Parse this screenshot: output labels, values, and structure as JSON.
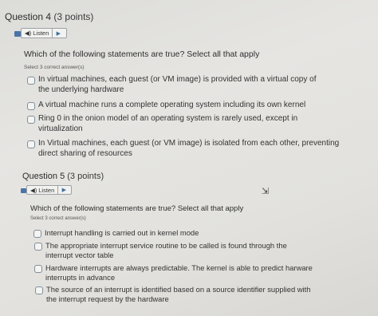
{
  "questions": [
    {
      "title": "Question 4",
      "points": "(3 points)",
      "listen_label": "Listen",
      "prompt": "Which of the following statements are true? Select all that apply",
      "select_hint": "Select 3 correct answer(s)",
      "options": [
        {
          "line1": "In virtual machines, each guest (or VM image) is provided with a virtual copy of",
          "line2": "the underlying hardware"
        },
        {
          "line1": "A virtual machine runs a complete operating system including its own kernel",
          "line2": ""
        },
        {
          "line1": "Ring 0 in the onion model of an operating system is rarely used, except in",
          "line2": "virtualization"
        },
        {
          "line1": "In Virtual machines, each guest (or VM image) is isolated from each other, preventing",
          "line2": "direct sharing of resources"
        }
      ]
    },
    {
      "title": "Question 5",
      "points": "(3 points)",
      "listen_label": "Listen",
      "prompt": "Which of the following statements are true? Select all that apply",
      "select_hint": "Select 3 correct answer(s)",
      "options": [
        {
          "line1": "Interrupt handling is carried out in kernel mode",
          "line2": ""
        },
        {
          "line1": "The appropriate interrupt service routine to be called is found through the",
          "line2": "interrupt vector table"
        },
        {
          "line1": "Hardware interrupts are always predictable. The kernel is able to predict harware",
          "line2": "interrupts in advance"
        },
        {
          "line1": "The source of an interrupt is identified based on a source identifier supplied with",
          "line2": "the interrupt request by the hardware"
        }
      ]
    }
  ],
  "icons": {
    "speaker": "speaker-icon",
    "play": "play-icon",
    "cursor": "mouse-cursor-icon",
    "grip": "grip-icon"
  }
}
